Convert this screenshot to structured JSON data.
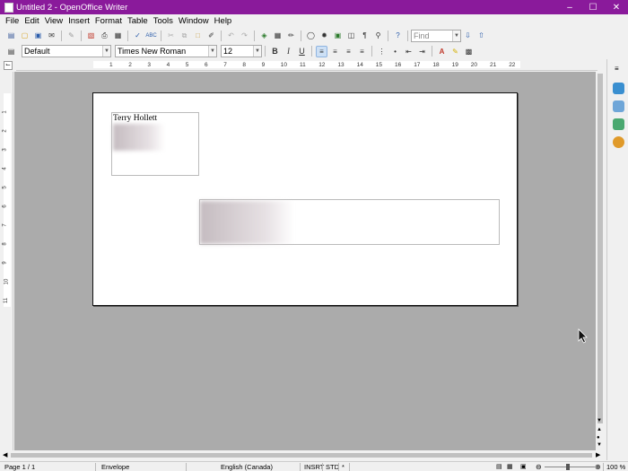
{
  "window": {
    "title": "Untitled 2 - OpenOffice Writer"
  },
  "menu": [
    "File",
    "Edit",
    "View",
    "Insert",
    "Format",
    "Table",
    "Tools",
    "Window",
    "Help"
  ],
  "formatting": {
    "style": "Default",
    "font": "Times New Roman",
    "size": "12"
  },
  "find": {
    "placeholder": "Find"
  },
  "ruler": {
    "h_labels": [
      "1",
      "2",
      "3",
      "4",
      "5",
      "6",
      "7",
      "8",
      "9",
      "10",
      "11",
      "12",
      "13",
      "14",
      "15",
      "16",
      "17",
      "18",
      "19",
      "20",
      "21",
      "22"
    ],
    "v_labels": [
      "1",
      "2",
      "3",
      "4",
      "5",
      "6",
      "7",
      "8",
      "9",
      "10",
      "11"
    ]
  },
  "document": {
    "sender_name": "Terry Hollett"
  },
  "status": {
    "page": "Page 1 / 1",
    "page_style": "Envelope",
    "language": "English (Canada)",
    "insert_mode": "INSRT",
    "selection_mode": "STD",
    "modified": "*",
    "zoom": "100 %"
  },
  "colors": {
    "titlebar": "#8a1a9b",
    "canvas": "#ababab"
  }
}
